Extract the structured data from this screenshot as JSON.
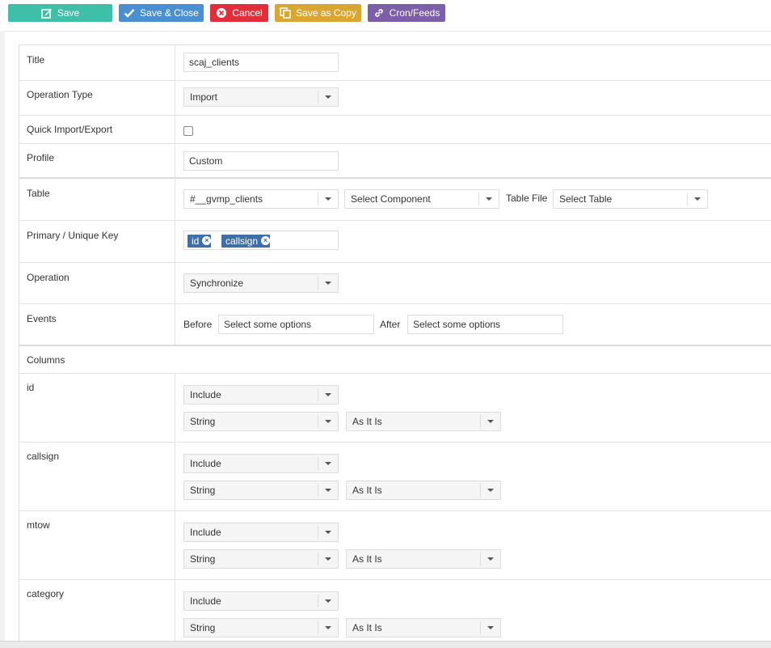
{
  "toolbar": {
    "save": "Save",
    "save_close": "Save & Close",
    "cancel": "Cancel",
    "save_copy": "Save as Copy",
    "cron": "Cron/Feeds"
  },
  "form": {
    "title": {
      "label": "Title",
      "value": "scaj_clients"
    },
    "operation_type": {
      "label": "Operation Type",
      "value": "Import"
    },
    "quick": {
      "label": "Quick Import/Export",
      "checked": false
    },
    "profile": {
      "label": "Profile",
      "value": "Custom"
    },
    "table": {
      "label": "Table",
      "table_value": "#__gvmp_clients",
      "component_value": "Select Component",
      "file_label": "Table File",
      "file_value": "Select Table"
    },
    "primary_key": {
      "label": "Primary / Unique Key",
      "tags": [
        "id",
        "callsign"
      ]
    },
    "operation": {
      "label": "Operation",
      "value": "Synchronize"
    },
    "events": {
      "label": "Events",
      "before_label": "Before",
      "before_placeholder": "Select some options",
      "after_label": "After",
      "after_placeholder": "Select some options"
    },
    "columns_label": "Columns",
    "columns": [
      {
        "name": "id",
        "include": "Include",
        "type": "String",
        "format": "As It Is"
      },
      {
        "name": "callsign",
        "include": "Include",
        "type": "String",
        "format": "As It Is"
      },
      {
        "name": "mtow",
        "include": "Include",
        "type": "String",
        "format": "As It Is"
      },
      {
        "name": "category",
        "include": "Include",
        "type": "String",
        "format": "As It Is"
      }
    ]
  }
}
